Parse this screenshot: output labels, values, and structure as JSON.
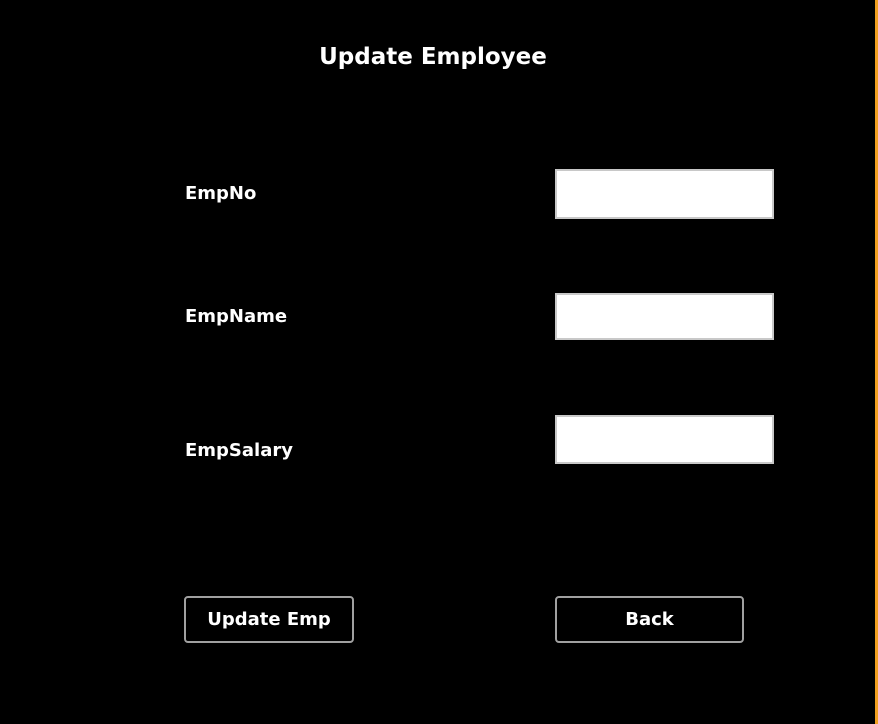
{
  "title": "Update Employee",
  "fields": [
    {
      "label": "EmpNo",
      "value": ""
    },
    {
      "label": "EmpName",
      "value": ""
    },
    {
      "label": "EmpSalary",
      "value": ""
    }
  ],
  "buttons": {
    "update": "Update Emp",
    "back": "Back"
  },
  "colors": {
    "accent_edge": "#f0a020"
  }
}
